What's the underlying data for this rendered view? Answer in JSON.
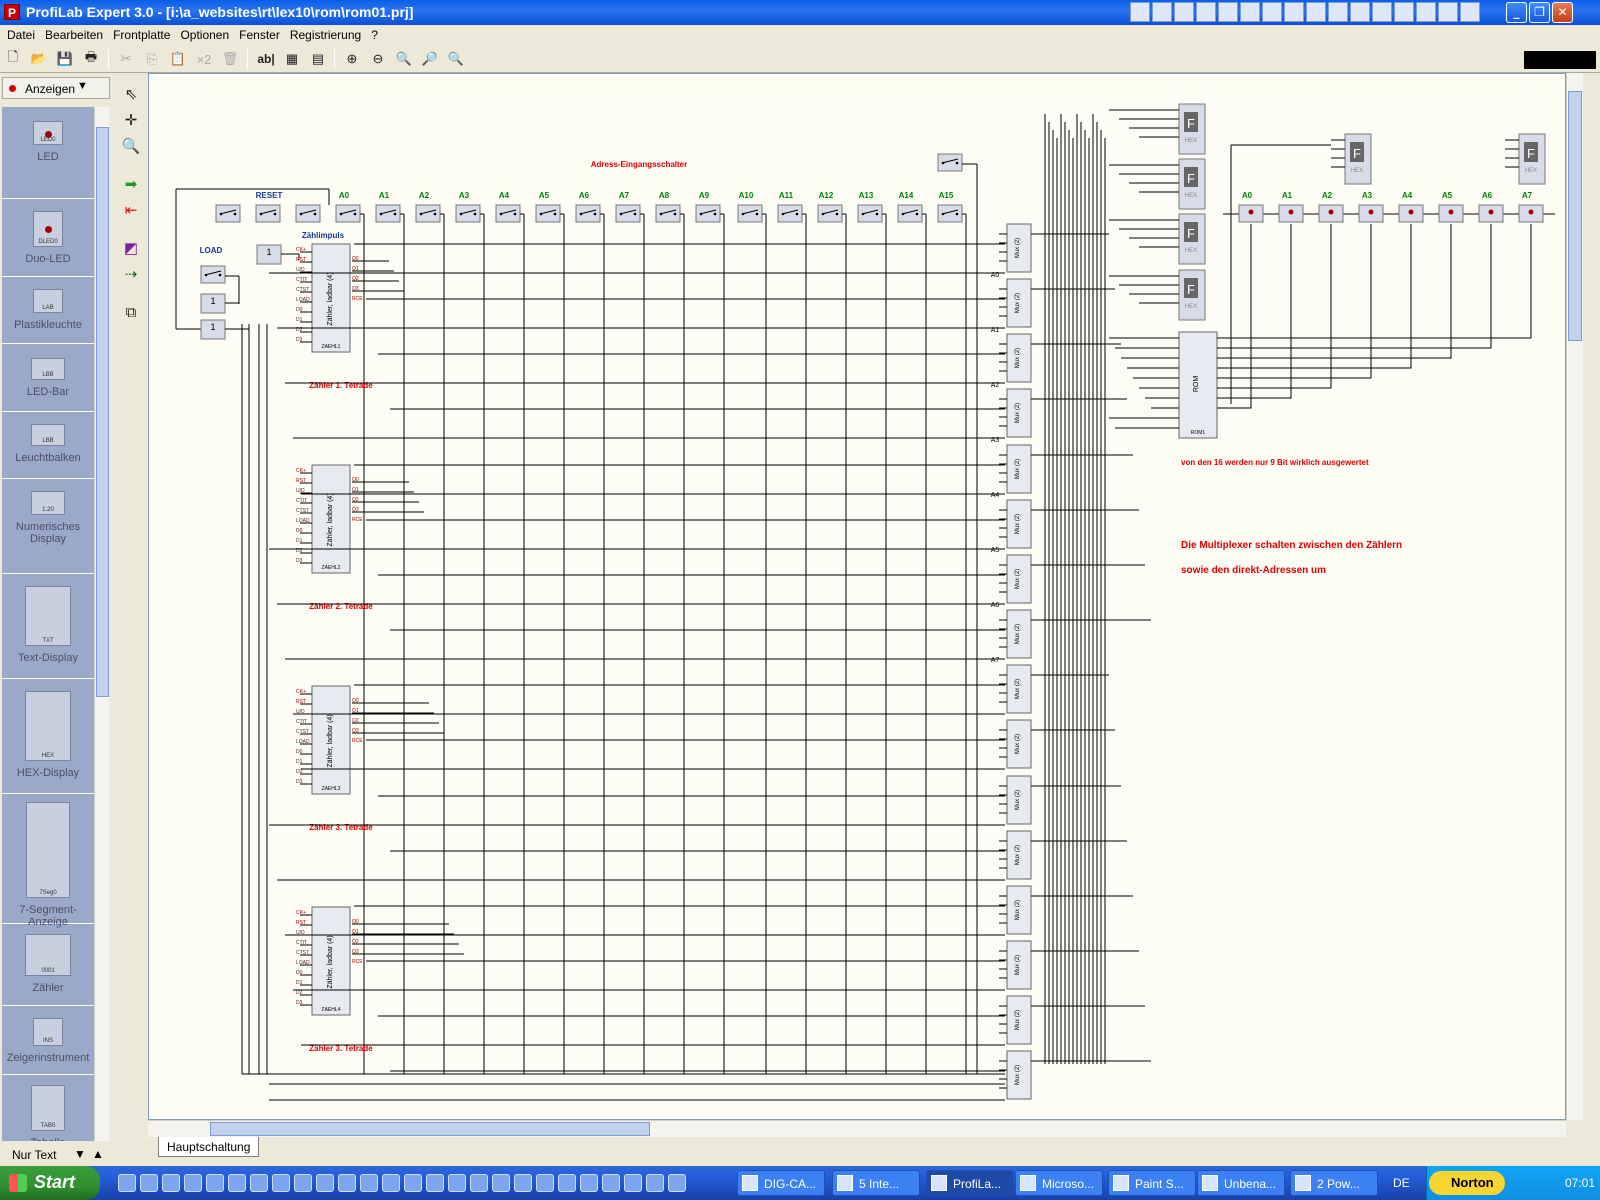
{
  "window": {
    "title": "ProfiLab Expert 3.0 - [i:\\a_websites\\rt\\lex10\\rom\\rom01.prj]",
    "app_icon": "P"
  },
  "menu": [
    "Datei",
    "Bearbeiten",
    "Frontplatte",
    "Optionen",
    "Fenster",
    "Registrierung",
    "?"
  ],
  "toolbar": {
    "buttons": [
      "new-icon",
      "open-icon",
      "save-icon",
      "print-icon",
      "cut-icon",
      "copy-icon",
      "paste-icon",
      "duplicate-icon",
      "delete-icon",
      "text-icon",
      "grid-icon",
      "grid-dense-icon",
      "zoom-in-icon",
      "zoom-out-icon",
      "zoom-fit-icon",
      "zoom-all-icon",
      "zoom-disabled-icon"
    ],
    "duplicate_label": "×2",
    "text_label": "ab|"
  },
  "palette": {
    "mode": "Anzeigen",
    "footer": "Nur Text",
    "items": [
      {
        "label": "LED",
        "icon_text": "LED0"
      },
      {
        "label": "Duo-LED",
        "icon_text": "DLED0"
      },
      {
        "label": "Plastikleuchte",
        "icon_text": "LAB"
      },
      {
        "label": "LED-Bar",
        "icon_text": "LBB"
      },
      {
        "label": "Leuchtbalken",
        "icon_text": "LBB"
      },
      {
        "label": "Numerisches Display",
        "icon_text": "1.20"
      },
      {
        "label": "Text-Display",
        "icon_text": "TXT"
      },
      {
        "label": "HEX-Display",
        "icon_text": "HEX"
      },
      {
        "label": "7-Segment-Anzeige",
        "icon_text": "7Seg0"
      },
      {
        "label": "Zähler",
        "icon_text": "0001"
      },
      {
        "label": "Zeigerinstrument",
        "icon_text": "INS"
      },
      {
        "label": "Tabelle",
        "icon_text": "TAB0"
      }
    ]
  },
  "vtools": [
    "pointer-icon",
    "crosshair-icon",
    "magnify-icon",
    "run-icon",
    "stop-icon",
    "color-icon",
    "connect-icon",
    "layer-icon"
  ],
  "circuit": {
    "header_label": "Adress-Eingangsschalter",
    "reset_label": "RESET",
    "load_label": "LOAD",
    "zaehlimpuls_label": "Zählimpuls",
    "address_labels": [
      "A0",
      "A1",
      "A2",
      "A3",
      "A4",
      "A5",
      "A6",
      "A7",
      "A8",
      "A9",
      "A10",
      "A11",
      "A12",
      "A13",
      "A14",
      "A15"
    ],
    "counter_block_label": "Zähler, ladbar (4)",
    "counter_labels": [
      "Zähler 1. Tetrade",
      "Zähler 2. Tetrade",
      "Zähler 3. Tetrade",
      "Zähler 3. Tetrade"
    ],
    "counter_ids": [
      "ZAEHL1",
      "ZAEHL2",
      "ZAEHL3",
      "ZAEHL4"
    ],
    "counter_inputs": [
      "CK+",
      "RST",
      "U/D",
      "CTIT",
      "CTST",
      "LOAD",
      "D0",
      "D1",
      "D2",
      "D3"
    ],
    "counter_outputs": [
      "Q0",
      "Q1",
      "Q2",
      "Q3",
      "RCE"
    ],
    "gate_label": "1",
    "mux_label": "Mux (2)",
    "mux_addr_labels": [
      "A0",
      "A1",
      "A2",
      "A3",
      "A4",
      "A5",
      "A6",
      "A7"
    ],
    "rom_label": "ROM",
    "rom_id": "ROM1",
    "hex_label": "HEX",
    "hex_char": "F",
    "led_labels": [
      "A0",
      "A1",
      "A2",
      "A3",
      "A4",
      "A5",
      "A6",
      "A7"
    ],
    "note1": "von den 16 werden nur 9 Bit wirklich ausgewertet",
    "note2": "Die Multiplexer schalten zwischen den Zählern",
    "note3": "sowie den direkt-Adressen um",
    "label_color": "#e00000",
    "address_color": "#008000",
    "control_color": "#1a3a9a"
  },
  "tab": "Hauptschaltung",
  "taskbar": {
    "start": "Start",
    "tasks": [
      "DIG-CA...",
      "5 Inte...",
      "ProfiLa...",
      "Microso...",
      "Paint S...",
      "Unbena...",
      "2 Pow..."
    ],
    "lang": "DE",
    "norton": "Norton",
    "clock": "07:01"
  }
}
